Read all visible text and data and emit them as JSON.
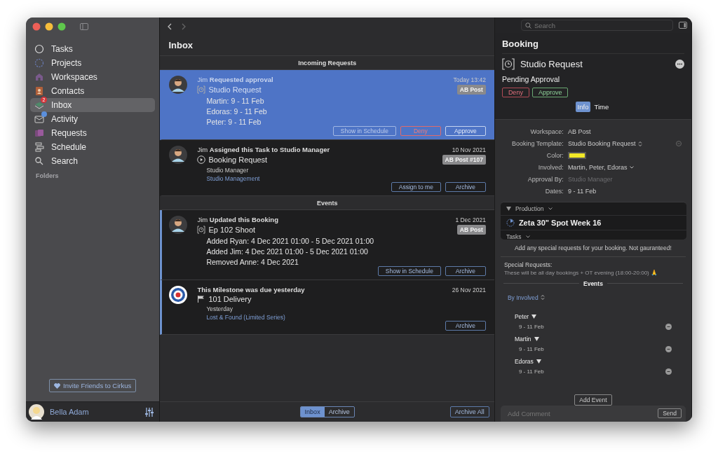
{
  "sidebar": {
    "items": [
      {
        "label": "Tasks",
        "selected": false,
        "notification": false
      },
      {
        "label": "Projects",
        "selected": false,
        "notification": false
      },
      {
        "label": "Workspaces",
        "selected": false,
        "notification": false
      },
      {
        "label": "Contacts",
        "selected": false,
        "notification": false
      },
      {
        "label": "Inbox",
        "selected": true,
        "badge": "2",
        "notification": false
      },
      {
        "label": "Activity",
        "selected": false,
        "notification": true
      },
      {
        "label": "Requests",
        "selected": false,
        "notification": false
      },
      {
        "label": "Schedule",
        "selected": false,
        "notification": false
      },
      {
        "label": "Search",
        "selected": false,
        "notification": false
      }
    ],
    "section": "Folders",
    "invite": "Invite Friends to Cirkus",
    "user": "Bella Adam"
  },
  "inbox": {
    "title": "Inbox",
    "sections": [
      {
        "heading": "Incoming Requests",
        "items": [
          {
            "kind": "request",
            "selected": true,
            "unread": false,
            "actor": "Jim",
            "action": "Requested approval",
            "date": "Today 13:42",
            "tag": "AB Post",
            "title": "Studio Request",
            "lines": [
              "Martin: 9 - 11 Feb",
              "Edoras: 9 - 11 Feb",
              "Peter: 9 - 11 Feb"
            ],
            "buttons": [
              {
                "label": "Show in Schedule",
                "kind": "normal",
                "disabled": true
              },
              {
                "label": "Deny",
                "kind": "deny",
                "disabled": false
              },
              {
                "label": "Approve",
                "kind": "normal",
                "disabled": false
              }
            ]
          },
          {
            "kind": "task",
            "selected": false,
            "unread": false,
            "actor": "Jim",
            "action": "Assigned this Task to Studio Manager",
            "date": "10 Nov 2021",
            "tag": "AB Post #107",
            "title": "Booking Request",
            "meta": [
              "Studio Manager"
            ],
            "link": "Studio Management",
            "buttons": [
              {
                "label": "Assign to me",
                "kind": "normal",
                "disabled": false
              },
              {
                "label": "Archive",
                "kind": "normal",
                "disabled": false
              }
            ]
          }
        ]
      },
      {
        "heading": "Events",
        "items": [
          {
            "kind": "booking",
            "selected": false,
            "unread": true,
            "actor": "Jim",
            "action": "Updated this Booking",
            "date": "1 Dec 2021",
            "tag": "AB Post",
            "title": "Ep 102 Shoot",
            "lines": [
              "Added Ryan: 4 Dec 2021 01:00 - 5 Dec 2021 01:00",
              "Added Jim: 4 Dec 2021 01:00 - 5 Dec 2021 01:00",
              "Removed Anne: 4 Dec 2021"
            ],
            "buttons": [
              {
                "label": "Show in Schedule",
                "kind": "normal",
                "disabled": false
              },
              {
                "label": "Archive",
                "kind": "normal",
                "disabled": false
              }
            ]
          },
          {
            "kind": "milestone",
            "selected": false,
            "unread": true,
            "action": "This Milestone was due yesterday",
            "date": "26 Nov 2021",
            "title": "101 Delivery",
            "meta": [
              "Yesterday"
            ],
            "link": "Lost & Found (Limited Series)",
            "buttons": [
              {
                "label": "Archive",
                "kind": "normal",
                "disabled": false
              }
            ]
          }
        ]
      }
    ],
    "footer": {
      "segments": [
        {
          "label": "Inbox",
          "selected": true
        },
        {
          "label": "Archive",
          "selected": false
        }
      ],
      "archive_all": "Archive All"
    }
  },
  "booking": {
    "search": {
      "placeholder": "Search"
    },
    "title": "Booking",
    "request": "Studio Request",
    "status": "Pending Approval",
    "deny": "Deny",
    "approve": "Approve",
    "tabs": [
      {
        "label": "Info",
        "selected": true
      },
      {
        "label": "Time",
        "selected": false
      }
    ],
    "fields": [
      {
        "label": "Workspace:",
        "kind": "text",
        "value": "AB Post",
        "disabled": false
      },
      {
        "label": "Booking Template:",
        "kind": "select",
        "value": "Studio Booking Request",
        "disabled": false
      },
      {
        "label": "Color:",
        "kind": "color",
        "color": "#f2e827"
      },
      {
        "label": "Involved:",
        "kind": "dropdown",
        "value": "Martin, Peter, Edoras",
        "disabled": false
      },
      {
        "label": "Approval By:",
        "kind": "text",
        "value": "Studio Manager",
        "disabled": true
      },
      {
        "label": "Dates:",
        "kind": "text",
        "value": "9 - 11 Feb",
        "disabled": false
      }
    ],
    "production": {
      "label": "Production",
      "project": "Zeta 30\" Spot Week 16",
      "tasks": "Tasks"
    },
    "note": "Add any special requests for your booking. Not gauranteed!",
    "special_label": "Special Requests:",
    "special_text": "These will be all day bookings + OT evening (18:00-20:00) 🙏",
    "events_heading": "Events",
    "group_by": "By Involved",
    "people": [
      {
        "name": "Peter",
        "dates": "9 - 11 Feb"
      },
      {
        "name": "Martin",
        "dates": "9 - 11 Feb"
      },
      {
        "name": "Edoras",
        "dates": "9 - 11 Feb"
      }
    ],
    "add_event": "Add Event",
    "comment": {
      "placeholder": "Add Comment"
    },
    "send": "Send"
  }
}
